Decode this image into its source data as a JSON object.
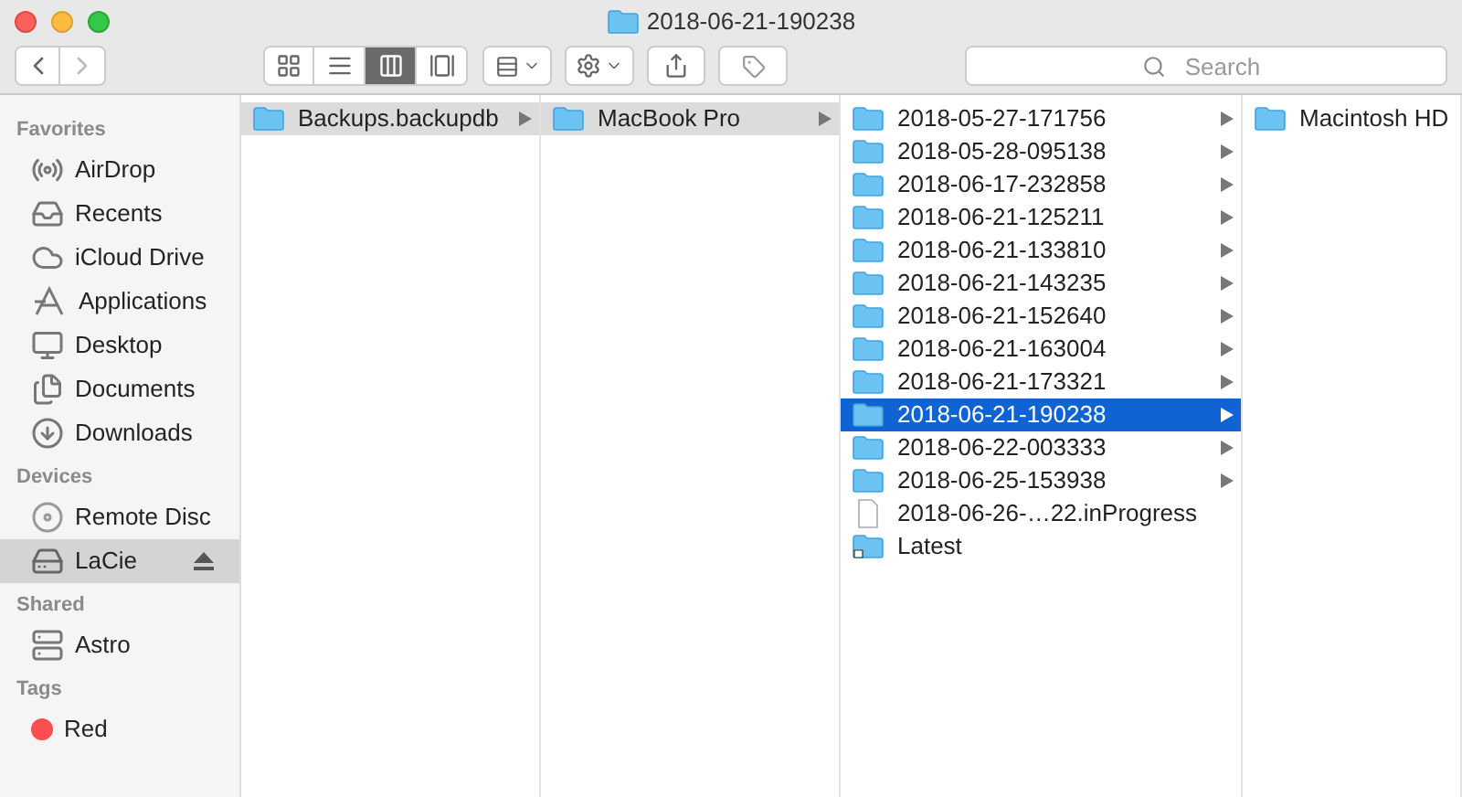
{
  "window": {
    "title": "2018-06-21-190238"
  },
  "toolbar": {
    "views": [
      {
        "kind": "icons",
        "selected": false
      },
      {
        "kind": "list",
        "selected": false
      },
      {
        "kind": "columns",
        "selected": true
      },
      {
        "kind": "gallery",
        "selected": false
      }
    ],
    "search": {
      "placeholder": "Search"
    }
  },
  "sidebar": [
    {
      "heading": "Favorites",
      "items": [
        {
          "label": "AirDrop",
          "kind": "airdrop",
          "selected": false
        },
        {
          "label": "Recents",
          "kind": "recents",
          "selected": false
        },
        {
          "label": "iCloud Drive",
          "kind": "cloud",
          "selected": false
        },
        {
          "label": "Applications",
          "kind": "apps",
          "selected": false
        },
        {
          "label": "Desktop",
          "kind": "desktop",
          "selected": false
        },
        {
          "label": "Documents",
          "kind": "documents",
          "selected": false
        },
        {
          "label": "Downloads",
          "kind": "downloads",
          "selected": false
        }
      ]
    },
    {
      "heading": "Devices",
      "items": [
        {
          "label": "Remote Disc",
          "kind": "disc",
          "selected": false,
          "ejectable": false
        },
        {
          "label": "LaCie",
          "kind": "drive",
          "selected": true,
          "ejectable": true
        }
      ]
    },
    {
      "heading": "Shared",
      "items": [
        {
          "label": "Astro",
          "kind": "server",
          "selected": false
        }
      ]
    },
    {
      "heading": "Tags",
      "items": [
        {
          "label": "Red",
          "kind": "tag",
          "selected": false,
          "color": "#fc4e4e"
        }
      ]
    }
  ],
  "columns": [
    {
      "items": [
        {
          "name": "Backups.backupdb",
          "kind": "folder",
          "selected": true,
          "focused": false,
          "expandable": true
        }
      ]
    },
    {
      "items": [
        {
          "name": "MacBook Pro",
          "kind": "folder",
          "selected": true,
          "focused": false,
          "expandable": true
        }
      ]
    },
    {
      "items": [
        {
          "name": "2018-05-27-171756",
          "kind": "folder",
          "selected": false,
          "expandable": true
        },
        {
          "name": "2018-05-28-095138",
          "kind": "folder",
          "selected": false,
          "expandable": true
        },
        {
          "name": "2018-06-17-232858",
          "kind": "folder",
          "selected": false,
          "expandable": true
        },
        {
          "name": "2018-06-21-125211",
          "kind": "folder",
          "selected": false,
          "expandable": true
        },
        {
          "name": "2018-06-21-133810",
          "kind": "folder",
          "selected": false,
          "expandable": true
        },
        {
          "name": "2018-06-21-143235",
          "kind": "folder",
          "selected": false,
          "expandable": true
        },
        {
          "name": "2018-06-21-152640",
          "kind": "folder",
          "selected": false,
          "expandable": true
        },
        {
          "name": "2018-06-21-163004",
          "kind": "folder",
          "selected": false,
          "expandable": true
        },
        {
          "name": "2018-06-21-173321",
          "kind": "folder",
          "selected": false,
          "expandable": true
        },
        {
          "name": "2018-06-21-190238",
          "kind": "folder",
          "selected": true,
          "focused": true,
          "expandable": true
        },
        {
          "name": "2018-06-22-003333",
          "kind": "folder",
          "selected": false,
          "expandable": true
        },
        {
          "name": "2018-06-25-153938",
          "kind": "folder",
          "selected": false,
          "expandable": true
        },
        {
          "name": "2018-06-26-…22.inProgress",
          "kind": "file",
          "selected": false,
          "expandable": false
        },
        {
          "name": "Latest",
          "kind": "alias",
          "selected": false,
          "expandable": false
        }
      ]
    },
    {
      "items": [
        {
          "name": "Macintosh HD",
          "kind": "folder",
          "selected": false,
          "expandable": false
        }
      ]
    }
  ]
}
